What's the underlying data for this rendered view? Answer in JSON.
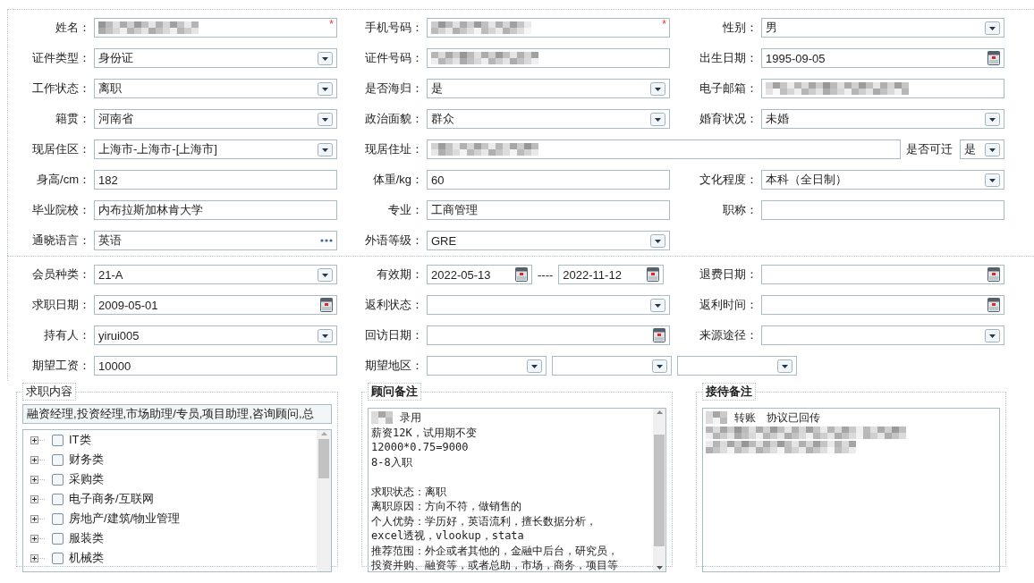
{
  "sections": [
    {
      "rows": [
        [
          {
            "label": "姓名：",
            "fields": [
              {
                "kind": "text",
                "redacted": true,
                "required_mark": "*"
              }
            ]
          },
          {
            "label": "手机号码：",
            "fields": [
              {
                "kind": "text",
                "redacted": true,
                "required_mark": "*"
              }
            ]
          },
          {
            "label": "性别：",
            "fields": [
              {
                "kind": "select",
                "value": "男"
              }
            ]
          }
        ],
        [
          {
            "label": "证件类型：",
            "fields": [
              {
                "kind": "select",
                "value": "身份证"
              }
            ]
          },
          {
            "label": "证件号码：",
            "fields": [
              {
                "kind": "text",
                "redacted": true
              }
            ]
          },
          {
            "label": "出生日期：",
            "fields": [
              {
                "kind": "date",
                "value": "1995-09-05"
              }
            ]
          }
        ],
        [
          {
            "label": "工作状态：",
            "fields": [
              {
                "kind": "select",
                "value": "离职"
              }
            ]
          },
          {
            "label": "是否海归：",
            "fields": [
              {
                "kind": "select",
                "value": "是"
              }
            ]
          },
          {
            "label": "电子邮箱：",
            "fields": [
              {
                "kind": "text",
                "redacted": true
              }
            ]
          }
        ],
        [
          {
            "label": "籍贯：",
            "fields": [
              {
                "kind": "select",
                "value": "河南省"
              }
            ]
          },
          {
            "label": "政治面貌：",
            "fields": [
              {
                "kind": "select",
                "value": "群众"
              }
            ]
          },
          {
            "label": "婚育状况：",
            "fields": [
              {
                "kind": "select",
                "value": "未婚"
              }
            ]
          }
        ],
        [
          {
            "label": "现居住区：",
            "fields": [
              {
                "kind": "select",
                "value": "上海市-上海市-[上海市]"
              }
            ]
          },
          {
            "label": "现居住址：",
            "kind": "wide",
            "fields": [
              {
                "kind": "text",
                "redacted": true
              }
            ],
            "trailing": {
              "label": "是否可迁",
              "fields": [
                {
                  "kind": "select",
                  "value": "是"
                }
              ]
            }
          }
        ],
        [
          {
            "label": "身高/cm：",
            "fields": [
              {
                "kind": "text",
                "value": "182"
              }
            ]
          },
          {
            "label": "体重/kg：",
            "fields": [
              {
                "kind": "text",
                "value": "60"
              }
            ]
          },
          {
            "label": "文化程度：",
            "fields": [
              {
                "kind": "select",
                "value": "本科（全日制）"
              }
            ]
          }
        ],
        [
          {
            "label": "毕业院校：",
            "fields": [
              {
                "kind": "text",
                "value": "内布拉斯加林肯大学"
              }
            ]
          },
          {
            "label": "专业：",
            "fields": [
              {
                "kind": "text",
                "value": "工商管理"
              }
            ]
          },
          {
            "label": "职称：",
            "fields": [
              {
                "kind": "text"
              }
            ]
          }
        ],
        [
          {
            "label": "通晓语言：",
            "fields": [
              {
                "kind": "more",
                "value": "英语"
              }
            ]
          },
          {
            "label": "外语等级：",
            "fields": [
              {
                "kind": "select",
                "value": "GRE"
              }
            ]
          }
        ]
      ]
    },
    {
      "rows": [
        [
          {
            "label": "会员种类：",
            "fields": [
              {
                "kind": "select",
                "value": "21-A"
              }
            ]
          },
          {
            "label": "有效期：",
            "kind": "range",
            "separator": "----",
            "fields": [
              {
                "kind": "date",
                "value": "2022-05-13"
              },
              {
                "kind": "date",
                "value": "2022-11-12"
              }
            ]
          },
          {
            "label": "退费日期：",
            "fields": [
              {
                "kind": "date"
              }
            ]
          }
        ],
        [
          {
            "label": "求职日期：",
            "fields": [
              {
                "kind": "date",
                "value": "2009-05-01"
              }
            ]
          },
          {
            "label": "返利状态：",
            "fields": [
              {
                "kind": "select"
              }
            ]
          },
          {
            "label": "返利时间：",
            "fields": [
              {
                "kind": "date"
              }
            ]
          }
        ],
        [
          {
            "label": "持有人：",
            "fields": [
              {
                "kind": "select",
                "value": "yirui005"
              }
            ]
          },
          {
            "label": "回访日期：",
            "fields": [
              {
                "kind": "date"
              }
            ]
          },
          {
            "label": "来源途径：",
            "fields": [
              {
                "kind": "select"
              }
            ]
          }
        ],
        [
          {
            "label": "期望工资：",
            "fields": [
              {
                "kind": "text",
                "value": "10000"
              }
            ]
          },
          {
            "label": "期望地区：",
            "kind": "triple",
            "fields": [
              {
                "kind": "select"
              },
              {
                "kind": "select"
              },
              {
                "kind": "select"
              }
            ]
          }
        ]
      ]
    }
  ],
  "job_content": {
    "legend": "求职内容",
    "value": "融资经理,投资经理,市场助理/专员,项目助理,咨询顾问,总",
    "tree": [
      {
        "label": "IT类",
        "expanded": false,
        "checked": false
      },
      {
        "label": "财务类",
        "expanded": false,
        "checked": false
      },
      {
        "label": "采购类",
        "expanded": false,
        "checked": false
      },
      {
        "label": "电子商务/互联网",
        "expanded": false,
        "checked": false
      },
      {
        "label": "房地产/建筑/物业管理",
        "expanded": false,
        "checked": false
      },
      {
        "label": "服装类",
        "expanded": false,
        "checked": false
      },
      {
        "label": "机械类",
        "expanded": false,
        "checked": false
      }
    ]
  },
  "notes": [
    {
      "legend": "顾问备注",
      "scrollbar": true,
      "lines": [
        {
          "text": "录用",
          "redacted": true
        },
        {
          "text": "薪资12K，试用期不变",
          "redacted": false
        },
        {
          "text": "12000*0.75=9000",
          "redacted": false
        },
        {
          "text": "8-8入职",
          "redacted": false
        },
        {
          "redacted": false
        },
        {
          "text": "求职状态：离职",
          "redacted": false
        },
        {
          "text": "离职原因：方向不符，做销售的",
          "redacted": false
        },
        {
          "text": "个人优势：学历好，英语流利，擅长数据分析，",
          "redacted": false
        },
        {
          "text": "excel透视，vlookup，stata",
          "redacted": false
        },
        {
          "text": "推荐范围：外企或者其他的，金融中后台，研究员，",
          "redacted": false
        },
        {
          "text": "投资并购、融资等，或者总助，市场，商务，项目等",
          "redacted": false
        }
      ]
    },
    {
      "legend": "接待备注",
      "scrollbar": false,
      "lines": [
        {
          "text": "转账　协议已回传",
          "redacted": true
        },
        {
          "redacted": true
        },
        {
          "redacted": true
        }
      ]
    }
  ]
}
